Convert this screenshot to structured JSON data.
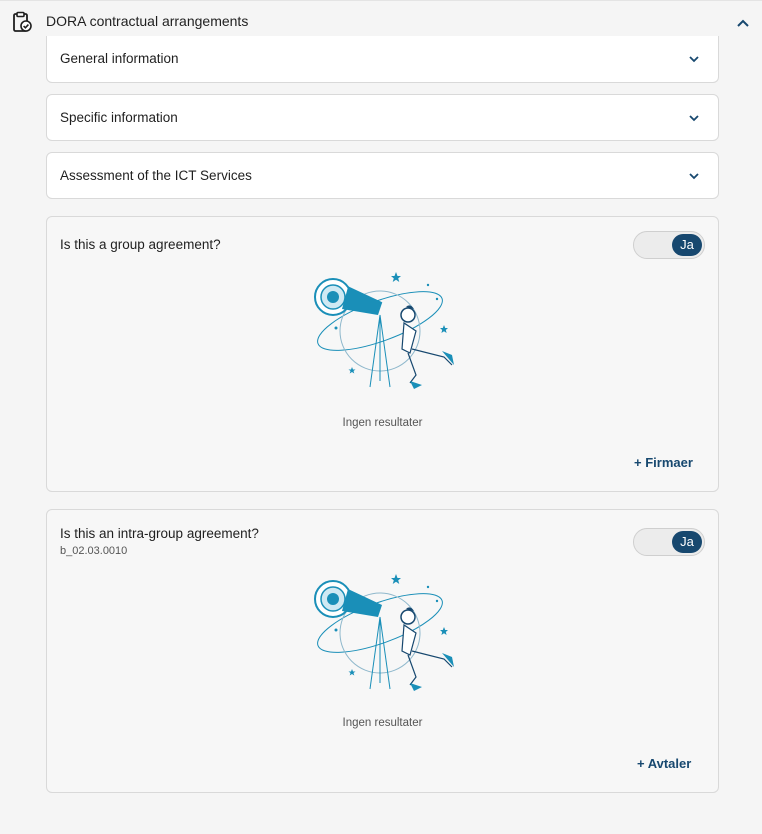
{
  "header": {
    "title": "DORA contractual arrangements",
    "icon": "clipboard-check-icon",
    "collapse_icon": "chevron-up-icon"
  },
  "sections": [
    {
      "label": "General information",
      "icon": "chevron-down-icon"
    },
    {
      "label": "Specific information",
      "icon": "chevron-down-icon"
    },
    {
      "label": "Assessment of the ICT Services",
      "icon": "chevron-down-icon"
    }
  ],
  "group_card": {
    "question": "Is this a group agreement?",
    "toggle_label": "Ja",
    "empty_text": "Ingen resultater",
    "add_label": "+ Firmaer"
  },
  "intra_card": {
    "question": "Is this an intra-group agreement?",
    "code": "b_02.03.0010",
    "toggle_label": "Ja",
    "empty_text": "Ingen resultater",
    "add_label": "+ Avtaler"
  },
  "colors": {
    "accent": "#17486f",
    "illustration": "#1a8fb8"
  }
}
